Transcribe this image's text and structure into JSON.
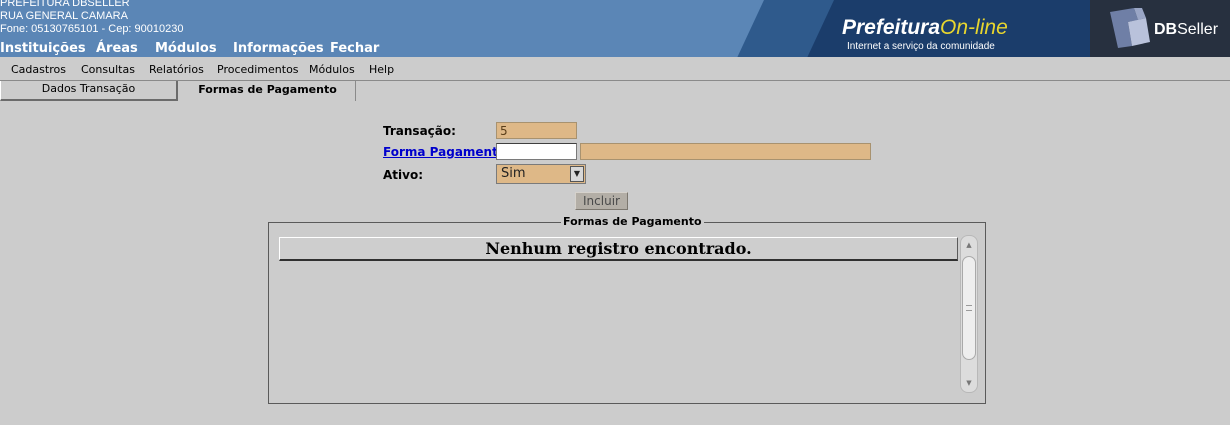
{
  "header": {
    "org_lines": [
      "PREFEITURA DBSELLER",
      "RUA GENERAL CAMARA",
      "Fone: 05130765101  -  Cep: 90010230"
    ],
    "nav": [
      "Instituições",
      "Áreas",
      "Módulos",
      "Informações",
      "Fechar"
    ],
    "brand_main": "Prefeitura",
    "brand_online": "On-line",
    "brand_sub": "Internet a serviço da comunidade",
    "db_bold": "DB",
    "db_rest": "Seller"
  },
  "menu": [
    "Cadastros",
    "Consultas",
    "Relatórios",
    "Procedimentos",
    "Módulos",
    "Help"
  ],
  "tabs": [
    "Dados Transação",
    "Formas de Pagamento"
  ],
  "form": {
    "transacao_label": "Transação:",
    "transacao_value": "5",
    "forma_label": "Forma Pagamento:",
    "forma_code": "",
    "forma_desc": "",
    "ativo_label": "Ativo:",
    "ativo_value": "Sim",
    "incluir_label": "Incluir"
  },
  "grid": {
    "legend": "Formas de Pagamento",
    "empty_message": "Nenhum registro encontrado."
  },
  "colors": {
    "header_blue": "#5b86b6",
    "banner_dark": "#1b3d6b",
    "readonly_field": "#deb887",
    "background": "#cccccc",
    "link": "#0000cc"
  }
}
